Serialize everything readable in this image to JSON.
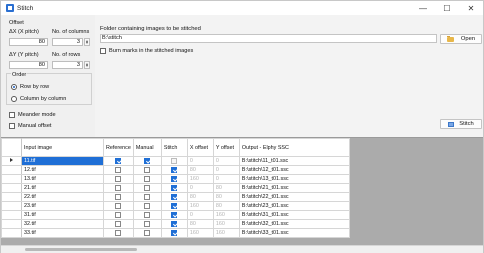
{
  "window": {
    "title": "Stitch",
    "controls": [
      "—",
      "☐",
      "✕"
    ]
  },
  "settings": {
    "offset_label": "Offset",
    "dx_label": "ΔX (X pitch)",
    "dx_value": "80",
    "cols_label": "No. of columns",
    "cols_value": "3",
    "dy_label": "ΔY (Y pitch)",
    "dy_value": "80",
    "rows_label": "No. of rows",
    "rows_value": "3",
    "order_label": "Order",
    "order_options": [
      "Row by row",
      "Column by column"
    ],
    "order_selected": "Row by row",
    "meander_label": "Meander mode",
    "manual_offset_label": "Manual offset"
  },
  "folder": {
    "label": "Folder containing images to be stitched",
    "value": "B:\\stitch",
    "open_label": "Open",
    "burn_marks_label": "Burn marks in the stitched images"
  },
  "stitch_button": "Stitch",
  "grid": {
    "columns": [
      "Input image",
      "Reference",
      "Manual",
      "Stitch",
      "X offset",
      "Y offset",
      "Output - Elphy SSC"
    ],
    "rows": [
      {
        "image": "11.tif",
        "reference": true,
        "manual": true,
        "stitch": false,
        "x": "0",
        "y": "0",
        "output": "B:\\stitch\\11_t01.ssc",
        "selected": true
      },
      {
        "image": "12.tif",
        "reference": false,
        "manual": false,
        "stitch": true,
        "x": "80",
        "y": "0",
        "output": "B:\\stitch\\12_t01.ssc",
        "selected": false
      },
      {
        "image": "13.tif",
        "reference": false,
        "manual": false,
        "stitch": true,
        "x": "160",
        "y": "0",
        "output": "B:\\stitch\\13_t01.ssc",
        "selected": false
      },
      {
        "image": "21.tif",
        "reference": false,
        "manual": false,
        "stitch": true,
        "x": "0",
        "y": "80",
        "output": "B:\\stitch\\21_t01.ssc",
        "selected": false
      },
      {
        "image": "22.tif",
        "reference": false,
        "manual": false,
        "stitch": true,
        "x": "80",
        "y": "80",
        "output": "B:\\stitch\\22_t01.ssc",
        "selected": false
      },
      {
        "image": "23.tif",
        "reference": false,
        "manual": false,
        "stitch": true,
        "x": "160",
        "y": "80",
        "output": "B:\\stitch\\23_t01.ssc",
        "selected": false
      },
      {
        "image": "31.tif",
        "reference": false,
        "manual": false,
        "stitch": true,
        "x": "0",
        "y": "160",
        "output": "B:\\stitch\\31_t01.ssc",
        "selected": false
      },
      {
        "image": "32.tif",
        "reference": false,
        "manual": false,
        "stitch": true,
        "x": "80",
        "y": "160",
        "output": "B:\\stitch\\32_t01.ssc",
        "selected": false
      },
      {
        "image": "33.tif",
        "reference": false,
        "manual": false,
        "stitch": true,
        "x": "160",
        "y": "160",
        "output": "B:\\stitch\\33_t01.ssc",
        "selected": false
      }
    ]
  },
  "colors": {
    "accent": "#1f6fd6",
    "grid_background": "#ababab"
  }
}
